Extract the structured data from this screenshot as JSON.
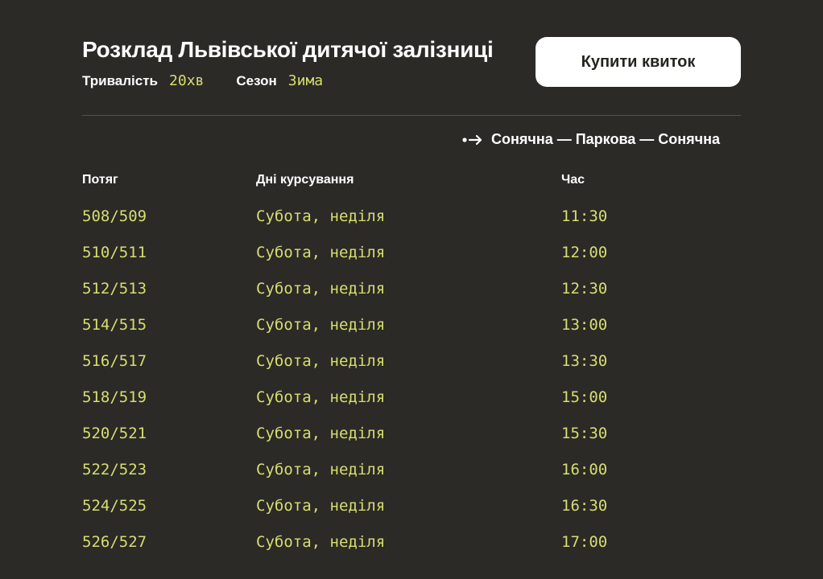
{
  "page": {
    "title": "Розклад Львівської дитячої залізниці",
    "meta": {
      "duration_label": "Тривалість",
      "duration_value": "20хв",
      "season_label": "Сезон",
      "season_value": "Зима"
    },
    "buy_button_label": "Купити квиток",
    "route": {
      "icon": "route-arrow-icon",
      "text": "Сонячна — Паркова — Сонячна"
    }
  },
  "table": {
    "headers": [
      "Потяг",
      "Дні курсування",
      "Час"
    ],
    "rows": [
      {
        "train": "508/509",
        "days": "Субота, неділя",
        "time": "11:30"
      },
      {
        "train": "510/511",
        "days": "Субота, неділя",
        "time": "12:00"
      },
      {
        "train": "512/513",
        "days": "Субота, неділя",
        "time": "12:30"
      },
      {
        "train": "514/515",
        "days": "Субота, неділя",
        "time": "13:00"
      },
      {
        "train": "516/517",
        "days": "Субота, неділя",
        "time": "13:30"
      },
      {
        "train": "518/519",
        "days": "Субота, неділя",
        "time": "15:00"
      },
      {
        "train": "520/521",
        "days": "Субота, неділя",
        "time": "15:30"
      },
      {
        "train": "522/523",
        "days": "Субота, неділя",
        "time": "16:00"
      },
      {
        "train": "524/525",
        "days": "Субота, неділя",
        "time": "16:30"
      },
      {
        "train": "526/527",
        "days": "Субота, неділя",
        "time": "17:00"
      }
    ]
  },
  "colors": {
    "background": "#2b2a27",
    "accent": "#d7de6f",
    "text": "#ffffff",
    "button_bg": "#ffffff",
    "button_text": "#26241f",
    "divider": "#54514c"
  }
}
